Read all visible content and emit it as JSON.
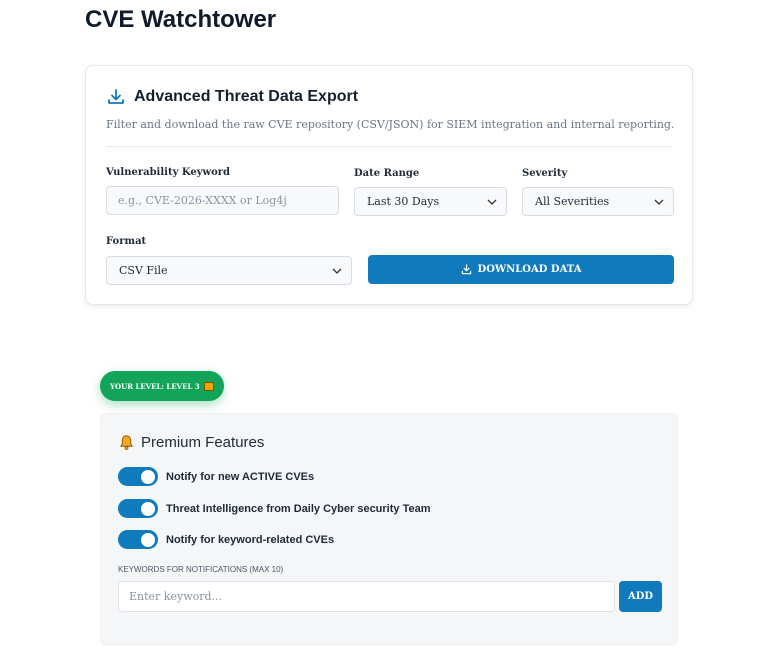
{
  "app": {
    "title": "CVE Watchtower"
  },
  "export": {
    "title": "Advanced Threat Data Export",
    "description": "Filter and download the raw CVE repository (CSV/JSON) for SIEM integration and internal reporting.",
    "keyword": {
      "label": "Vulnerability Keyword",
      "placeholder": "e.g., CVE-2026-XXXX or Log4j",
      "value": ""
    },
    "date_range": {
      "label": "Date Range",
      "value": "Last 30 Days"
    },
    "severity": {
      "label": "Severity",
      "value": "All Severities"
    },
    "format": {
      "label": "Format",
      "value": "CSV File"
    },
    "download_label": "DOWNLOAD DATA"
  },
  "level_badge": {
    "text": "YOUR LEVEL: LEVEL 3"
  },
  "premium": {
    "title": "Premium Features",
    "toggles": [
      {
        "label": "Notify for new ACTIVE CVEs",
        "on": true
      },
      {
        "label": "Threat Intelligence from Daily Cyber security Team",
        "on": true
      },
      {
        "label": "Notify for keyword-related CVEs",
        "on": true
      }
    ],
    "keywords_label": "KEYWORDS FOR NOTIFICATIONS (MAX 10)",
    "keyword_placeholder": "Enter keyword...",
    "add_label": "ADD"
  },
  "colors": {
    "accent": "#0f7bbd",
    "badge": "#12a55a"
  }
}
